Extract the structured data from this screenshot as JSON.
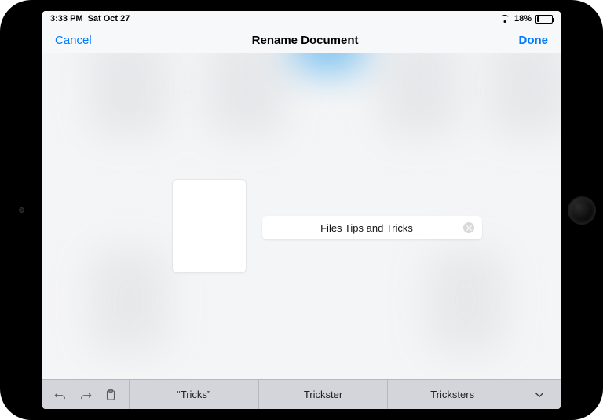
{
  "statusbar": {
    "time": "3:33 PM",
    "date": "Sat Oct 27",
    "battery_pct": "18%",
    "battery_fill_pct": 18
  },
  "navbar": {
    "cancel": "Cancel",
    "title": "Rename Document",
    "done": "Done"
  },
  "rename": {
    "value": "Files Tips and Tricks"
  },
  "keyboard": {
    "suggestions": [
      "“Tricks”",
      "Trickster",
      "Tricksters"
    ]
  }
}
